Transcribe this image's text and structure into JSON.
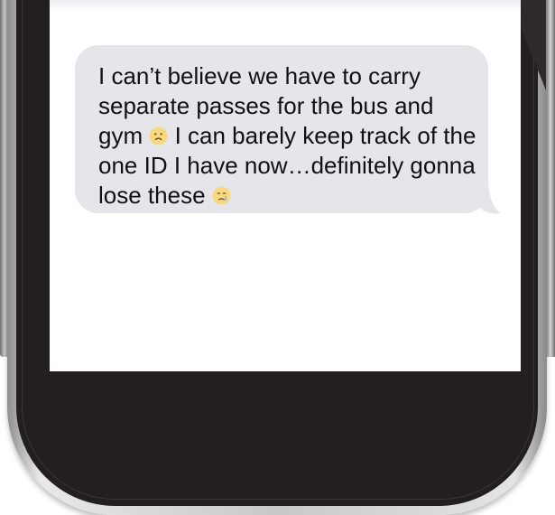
{
  "message": {
    "part1": "I can’t believe we have to carry separate passes for the bus and gym",
    "part2": "I can barely keep track of the one ID I have now…definitely gonna lose these",
    "emoji1": "frowning-face-emoji",
    "emoji2": "crying-face-emoji"
  },
  "colors": {
    "bubble": "#e5e5ea",
    "text": "#111111",
    "phone_body": "#231f20",
    "screen": "#ffffff"
  }
}
